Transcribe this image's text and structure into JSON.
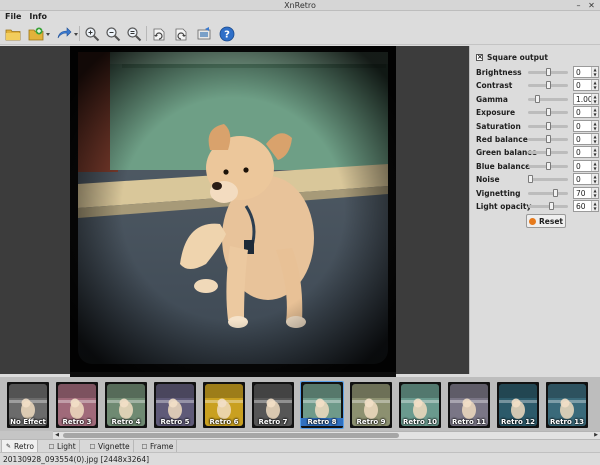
{
  "window": {
    "title": "XnRetro"
  },
  "menu": [
    "File",
    "Info"
  ],
  "toolbar": [
    {
      "name": "open-folder-icon",
      "has_menu": false
    },
    {
      "name": "add-image-icon",
      "has_menu": true
    },
    {
      "name": "export-icon",
      "has_menu": true
    },
    {
      "name": "zoom-in-icon",
      "has_menu": false
    },
    {
      "name": "zoom-out-icon",
      "has_menu": false
    },
    {
      "name": "zoom-fit-icon",
      "has_menu": false
    },
    {
      "name": "rotate-left-icon",
      "has_menu": false
    },
    {
      "name": "rotate-right-icon",
      "has_menu": false
    },
    {
      "name": "share-icon",
      "has_menu": false
    },
    {
      "name": "help-icon",
      "has_menu": false
    }
  ],
  "adjust": {
    "square_output_label": "Square output",
    "square_output_checked": true,
    "params": [
      {
        "key": "brightness",
        "label": "Brightness",
        "value": "0",
        "level": 0.5
      },
      {
        "key": "contrast",
        "label": "Contrast",
        "value": "0",
        "level": 0.5
      },
      {
        "key": "gamma",
        "label": "Gamma",
        "value": "1.00",
        "level": 0.2
      },
      {
        "key": "exposure",
        "label": "Exposure",
        "value": "0",
        "level": 0.5
      },
      {
        "key": "saturation",
        "label": "Saturation",
        "value": "0",
        "level": 0.5
      },
      {
        "key": "red-balance",
        "label": "Red balance",
        "value": "0",
        "level": 0.5
      },
      {
        "key": "green-balance",
        "label": "Green balance",
        "value": "0",
        "level": 0.5
      },
      {
        "key": "blue-balance",
        "label": "Blue balance",
        "value": "0",
        "level": 0.5
      },
      {
        "key": "noise",
        "label": "Noise",
        "value": "0",
        "level": 0.0
      },
      {
        "key": "vignetting",
        "label": "Vignetting",
        "value": "70",
        "level": 0.7
      },
      {
        "key": "light-opacity",
        "label": "Light opacity",
        "value": "60",
        "level": 0.6
      }
    ],
    "reset_label": "Reset"
  },
  "effects": [
    {
      "label": "No Effect",
      "tint": "#6b6b6b",
      "selected": false
    },
    {
      "label": "Retro 3",
      "tint": "#a06a7a",
      "selected": false
    },
    {
      "label": "Retro 4",
      "tint": "#6f8a72",
      "selected": false
    },
    {
      "label": "Retro 5",
      "tint": "#5f5a78",
      "selected": false
    },
    {
      "label": "Retro 6",
      "tint": "#c9a020",
      "selected": false
    },
    {
      "label": "Retro 7",
      "tint": "#565656",
      "selected": false
    },
    {
      "label": "Retro 8",
      "tint": "#6f9a8a",
      "selected": true
    },
    {
      "label": "Retro 9",
      "tint": "#8c9070",
      "selected": false
    },
    {
      "label": "Retro 10",
      "tint": "#6a9a8e",
      "selected": false
    },
    {
      "label": "Retro 11",
      "tint": "#7a7686",
      "selected": false
    },
    {
      "label": "Retro 12",
      "tint": "#2c5a6a",
      "selected": false
    },
    {
      "label": "Retro 13",
      "tint": "#3a6a7a",
      "selected": false
    }
  ],
  "colors": {
    "selection": "#3070c0",
    "reset_icon": "#e67a1c"
  },
  "tabs": [
    {
      "label": "Retro",
      "icon": "retro-tab-icon",
      "active": true
    },
    {
      "label": "Light",
      "icon": "light-tab-icon",
      "active": false
    },
    {
      "label": "Vignette",
      "icon": "vignette-tab-icon",
      "active": false
    },
    {
      "label": "Frame",
      "icon": "frame-tab-icon",
      "active": false
    }
  ],
  "status": {
    "text": "20130928_093554(0).jpg [2448x3264]"
  }
}
